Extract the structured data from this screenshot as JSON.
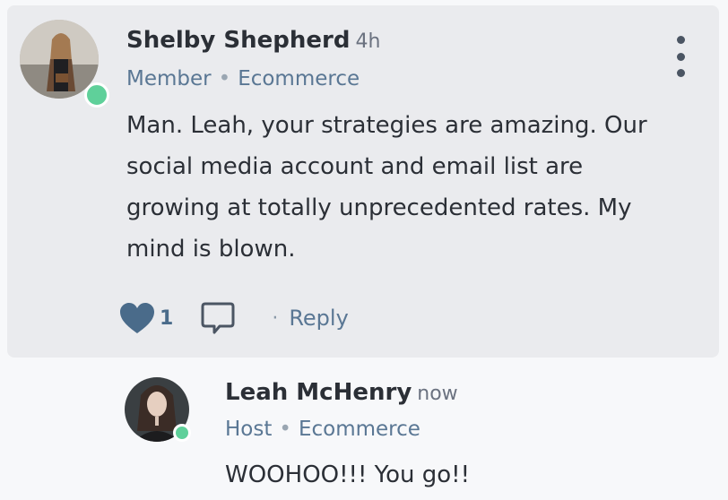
{
  "comment": {
    "author": "Shelby Shepherd",
    "time": "4h",
    "role": "Member",
    "group": "Ecommerce",
    "body_lines": [
      "Man. Leah, your strategies are amazing. Our",
      "social media account and email list are",
      "growing at totally unprecedented rates. My",
      "mind is blown."
    ],
    "like_count": "1",
    "reply_label": "Reply",
    "dot_separator": "·",
    "meta_separator": "•",
    "icons": {
      "like": "heart-icon",
      "comment": "comment-bubble-icon",
      "more": "more-vertical-icon"
    }
  },
  "reply": {
    "author": "Leah McHenry",
    "time": "now",
    "role": "Host",
    "group": "Ecommerce",
    "body": "WOOHOO!!! You go!!"
  },
  "colors": {
    "card_bg": "#eaebee",
    "online": "#5fd09a",
    "accent": "#4a6b8a"
  }
}
